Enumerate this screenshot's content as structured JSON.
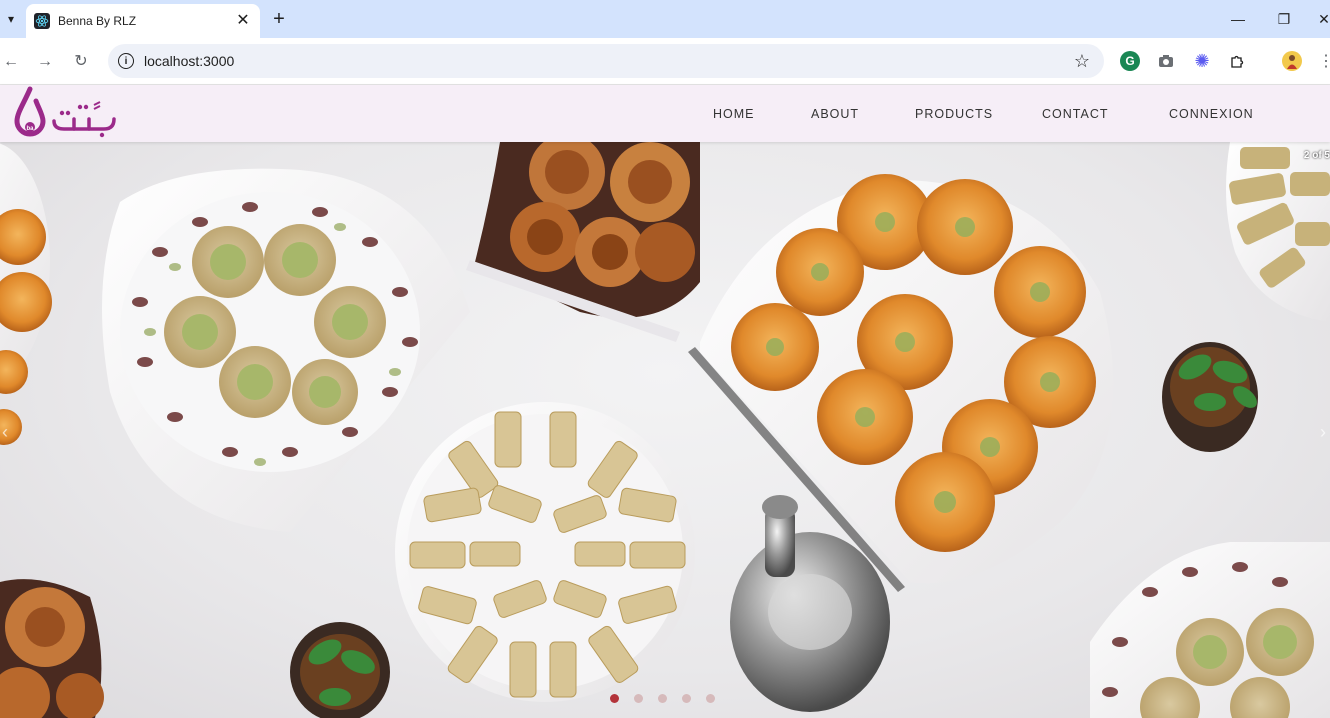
{
  "browser": {
    "tab_title": "Benna By RLZ",
    "url": "localhost:3000"
  },
  "site": {
    "nav": [
      "HOME",
      "ABOUT",
      "PRODUCTS",
      "CONTACT",
      "CONNEXION"
    ]
  },
  "carousel": {
    "counter": "2 of 5",
    "slide_count": 5,
    "active_slide": 1
  },
  "colors": {
    "header_bg": "#f6eef7",
    "brand_purple": "#9b2a8a",
    "tab_strip": "#d3e3fd"
  }
}
